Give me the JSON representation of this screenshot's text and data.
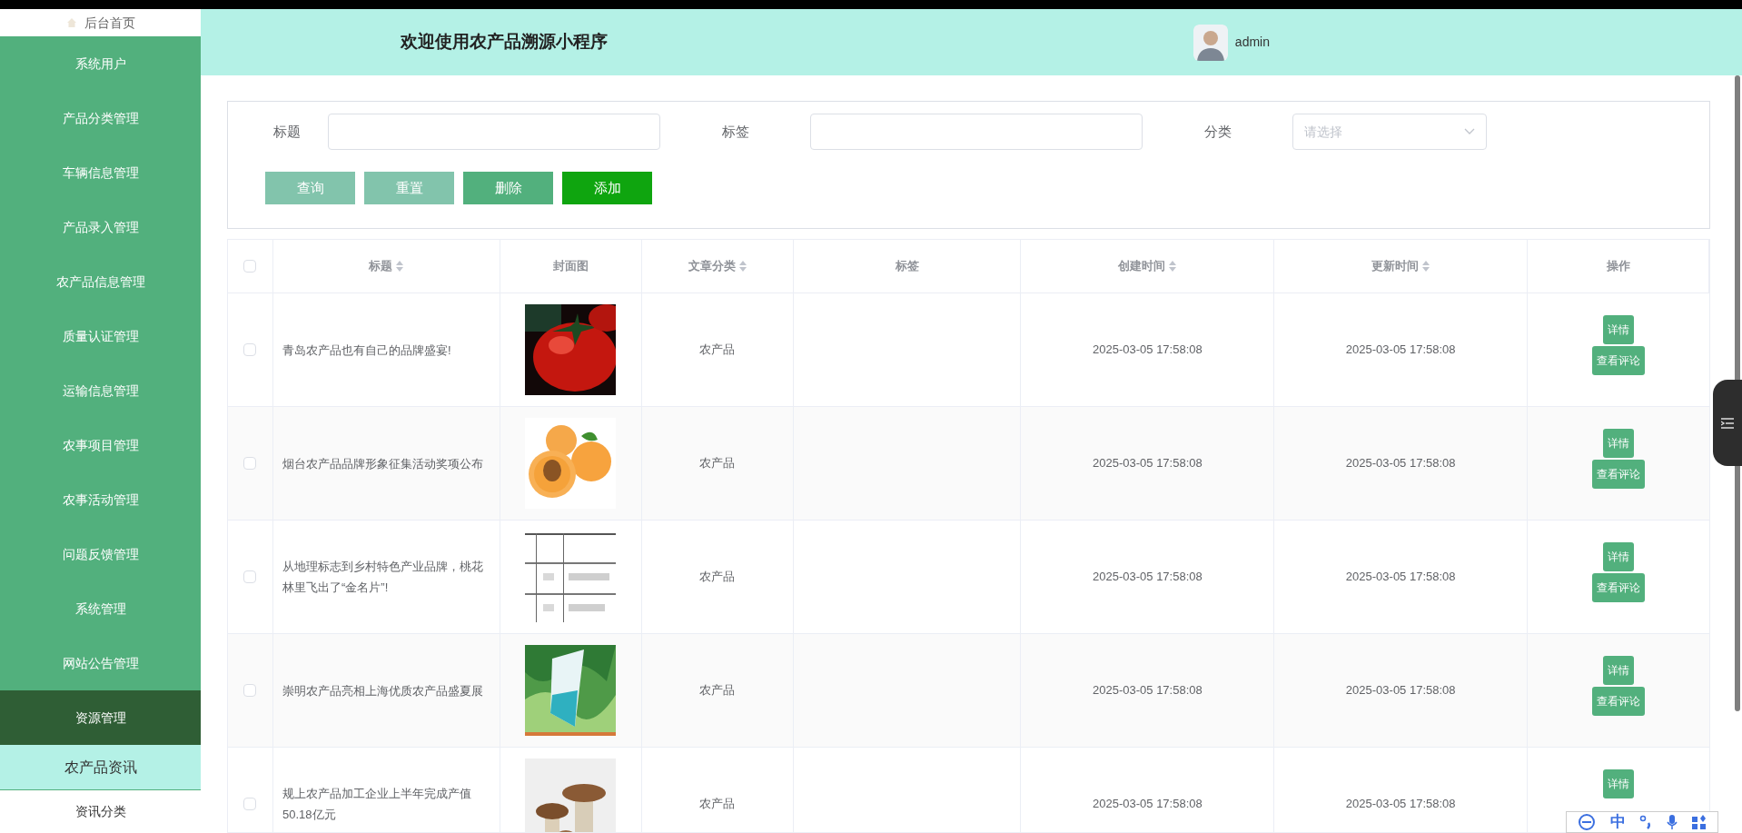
{
  "sidebar": {
    "items": [
      {
        "label": "后台首页",
        "kind": "home",
        "selected": false
      },
      {
        "label": "系统用户",
        "kind": "menu",
        "selected": false
      },
      {
        "label": "产品分类管理",
        "kind": "menu",
        "selected": false
      },
      {
        "label": "车辆信息管理",
        "kind": "menu",
        "selected": false
      },
      {
        "label": "产品录入管理",
        "kind": "menu",
        "selected": false
      },
      {
        "label": "农产品信息管理",
        "kind": "menu",
        "selected": false
      },
      {
        "label": "质量认证管理",
        "kind": "menu",
        "selected": false
      },
      {
        "label": "运输信息管理",
        "kind": "menu",
        "selected": false
      },
      {
        "label": "农事项目管理",
        "kind": "menu",
        "selected": false
      },
      {
        "label": "农事活动管理",
        "kind": "menu",
        "selected": false
      },
      {
        "label": "问题反馈管理",
        "kind": "menu",
        "selected": false
      },
      {
        "label": "系统管理",
        "kind": "menu",
        "selected": false
      },
      {
        "label": "网站公告管理",
        "kind": "menu",
        "selected": false
      },
      {
        "label": "资源管理",
        "kind": "menu",
        "selected": true,
        "children": [
          {
            "label": "农产品资讯",
            "selected": true
          },
          {
            "label": "资讯分类",
            "selected": false
          }
        ]
      }
    ]
  },
  "header": {
    "title": "欢迎使用农产品溯源小程序",
    "user": "admin"
  },
  "search": {
    "fields": [
      {
        "label": "标题",
        "kind": "text"
      },
      {
        "label": "标签",
        "kind": "text"
      },
      {
        "label": "分类",
        "kind": "select",
        "placeholder": "请选择"
      }
    ],
    "buttons": [
      {
        "label": "查询",
        "color": "#82c4ac"
      },
      {
        "label": "重置",
        "color": "#82c4ac"
      },
      {
        "label": "删除",
        "color": "#52b07d"
      },
      {
        "label": "添加",
        "color": "#0fa50f"
      }
    ]
  },
  "table": {
    "header_checked": false,
    "columns": [
      {
        "label": "标题",
        "sortable": true
      },
      {
        "label": "封面图",
        "sortable": false
      },
      {
        "label": "文章分类",
        "sortable": true
      },
      {
        "label": "标签",
        "sortable": false
      },
      {
        "label": "创建时间",
        "sortable": true
      },
      {
        "label": "更新时间",
        "sortable": true
      },
      {
        "label": "操作",
        "sortable": false
      }
    ],
    "rows": [
      {
        "checked": false,
        "title": "青岛农产品也有自己的品牌盛宴!",
        "category": "农产品",
        "created": "2025-03-05 17:58:08",
        "updated": "2025-03-05 17:58:08",
        "actions": [
          "详情",
          "查看评论"
        ]
      },
      {
        "checked": false,
        "title": "烟台农产品品牌形象征集活动奖项公布",
        "category": "农产品",
        "created": "2025-03-05 17:58:08",
        "updated": "2025-03-05 17:58:08",
        "actions": [
          "详情",
          "查看评论"
        ]
      },
      {
        "checked": false,
        "title": "从地理标志到乡村特色产业品牌，桃花林里飞出了“金名片”!",
        "category": "农产品",
        "created": "2025-03-05 17:58:08",
        "updated": "2025-03-05 17:58:08",
        "actions": [
          "详情",
          "查看评论"
        ]
      },
      {
        "checked": false,
        "title": "崇明农产品亮相上海优质农产品盛夏展",
        "category": "农产品",
        "created": "2025-03-05 17:58:08",
        "updated": "2025-03-05 17:58:08",
        "actions": [
          "详情",
          "查看评论"
        ]
      },
      {
        "checked": false,
        "title": "规上农产品加工企业上半年完成产值50.18亿元",
        "category": "农产品",
        "created": "2025-03-05 17:58:08",
        "updated": "2025-03-05 17:58:08",
        "actions": [
          "详情"
        ]
      }
    ]
  },
  "ime_toolbar": {
    "mode": "中"
  }
}
